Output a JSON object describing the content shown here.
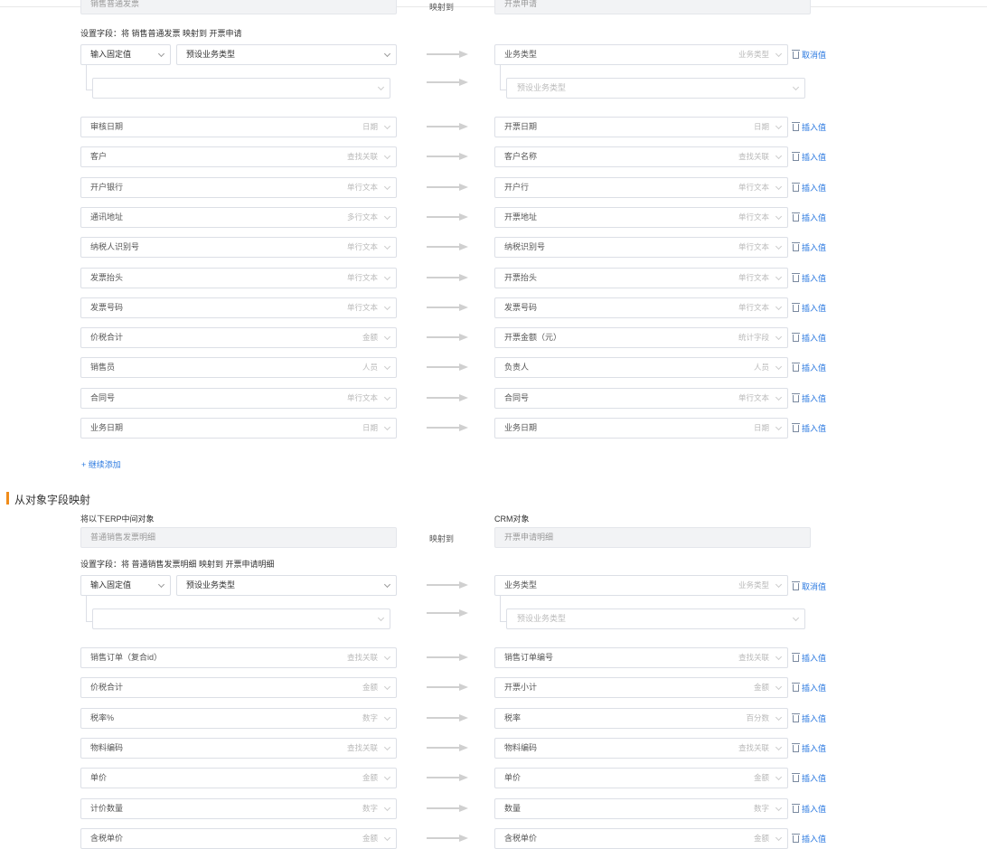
{
  "top": {
    "erp_object": "销售普通发票",
    "map_to": "映射到",
    "crm_object": "开票申请",
    "set_fields": "设置字段：将 销售普通发票 映射到 开票申请",
    "preset_row": {
      "input_type": "输入固定值",
      "value": "预设业务类型",
      "crm_field": "业务类型",
      "crm_type": "业务类型",
      "sub_placeholder": "预设业务类型",
      "action": "取消值"
    },
    "rows": [
      {
        "erp": "审核日期",
        "erp_type": "日期",
        "crm": "开票日期",
        "crm_type": "日期",
        "action": "插入值"
      },
      {
        "erp": "客户",
        "erp_type": "查找关联",
        "crm": "客户名称",
        "crm_type": "查找关联",
        "action": "插入值"
      },
      {
        "erp": "开户银行",
        "erp_type": "单行文本",
        "crm": "开户行",
        "crm_type": "单行文本",
        "action": "插入值"
      },
      {
        "erp": "通讯地址",
        "erp_type": "多行文本",
        "crm": "开票地址",
        "crm_type": "单行文本",
        "action": "插入值"
      },
      {
        "erp": "纳税人识别号",
        "erp_type": "单行文本",
        "crm": "纳税识别号",
        "crm_type": "单行文本",
        "action": "插入值"
      },
      {
        "erp": "发票抬头",
        "erp_type": "单行文本",
        "crm": "开票抬头",
        "crm_type": "单行文本",
        "action": "插入值"
      },
      {
        "erp": "发票号码",
        "erp_type": "单行文本",
        "crm": "发票号码",
        "crm_type": "单行文本",
        "action": "插入值"
      },
      {
        "erp": "价税合计",
        "erp_type": "金额",
        "crm": "开票金额（元）",
        "crm_type": "统计字段",
        "action": "插入值"
      },
      {
        "erp": "销售员",
        "erp_type": "人员",
        "crm": "负责人",
        "crm_type": "人员",
        "action": "插入值"
      },
      {
        "erp": "合同号",
        "erp_type": "单行文本",
        "crm": "合同号",
        "crm_type": "单行文本",
        "action": "插入值"
      },
      {
        "erp": "业务日期",
        "erp_type": "日期",
        "crm": "业务日期",
        "crm_type": "日期",
        "action": "插入值"
      }
    ],
    "add_more": "+ 继续添加"
  },
  "detail": {
    "section_title": "从对象字段映射",
    "erp_label": "将以下ERP中间对象",
    "crm_label": "CRM对象",
    "erp_object": "普通销售发票明细",
    "map_to": "映射到",
    "crm_object": "开票申请明细",
    "set_fields": "设置字段：将 普通销售发票明细 映射到 开票申请明细",
    "preset_row": {
      "input_type": "输入固定值",
      "value": "预设业务类型",
      "crm_field": "业务类型",
      "crm_type": "业务类型",
      "sub_placeholder": "预设业务类型",
      "action": "取消值"
    },
    "rows": [
      {
        "erp": "销售订单（复合id）",
        "erp_type": "查找关联",
        "crm": "销售订单编号",
        "crm_type": "查找关联",
        "action": "插入值"
      },
      {
        "erp": "价税合计",
        "erp_type": "金额",
        "crm": "开票小计",
        "crm_type": "金额",
        "action": "插入值"
      },
      {
        "erp": "税率%",
        "erp_type": "数字",
        "crm": "税率",
        "crm_type": "百分数",
        "action": "插入值"
      },
      {
        "erp": "物料编码",
        "erp_type": "查找关联",
        "crm": "物料编码",
        "crm_type": "查找关联",
        "action": "插入值"
      },
      {
        "erp": "单价",
        "erp_type": "金额",
        "crm": "单价",
        "crm_type": "金额",
        "action": "插入值"
      },
      {
        "erp": "计价数量",
        "erp_type": "数字",
        "crm": "数量",
        "crm_type": "数字",
        "action": "插入值"
      },
      {
        "erp": "含税单价",
        "erp_type": "金额",
        "crm": "含税单价",
        "crm_type": "金额",
        "action": "插入值"
      }
    ]
  },
  "colors": {
    "accent": "#2c7ae0",
    "section_bar": "#f08c1a",
    "border": "#dcdfe6",
    "disabled_bg": "#f2f3f5"
  }
}
